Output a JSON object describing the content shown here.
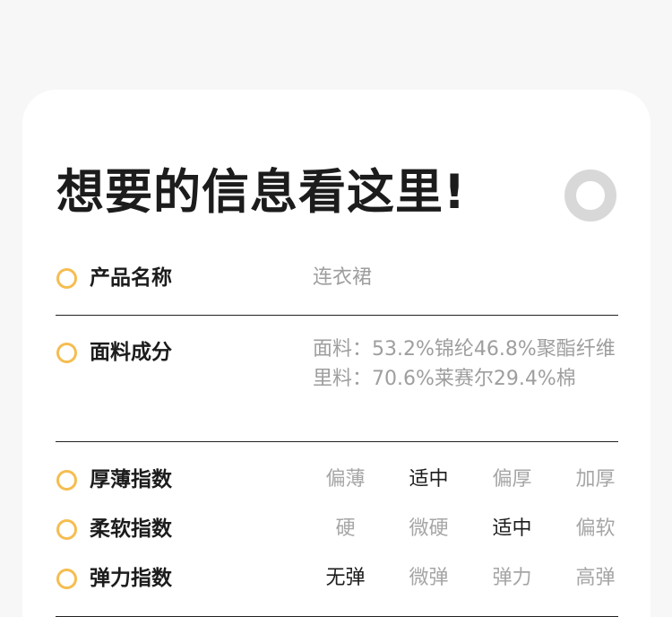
{
  "card": {
    "title": "想要的信息看这里!"
  },
  "info": {
    "product_name": {
      "label": "产品名称",
      "value": "连衣裙"
    },
    "fabric": {
      "label": "面料成分",
      "lines": [
        "面料：53.2%锦纶46.8%聚酯纤维",
        "里料：70.6%莱赛尔29.4%棉"
      ]
    }
  },
  "indices": [
    {
      "label": "厚薄指数",
      "options": [
        "偏薄",
        "适中",
        "偏厚",
        "加厚"
      ],
      "selected": 1
    },
    {
      "label": "柔软指数",
      "options": [
        "硬",
        "微硬",
        "适中",
        "偏软"
      ],
      "selected": 2
    },
    {
      "label": "弹力指数",
      "options": [
        "无弹",
        "微弹",
        "弹力",
        "高弹"
      ],
      "selected": 0
    }
  ],
  "colors": {
    "accent_ring": "#f5bd50",
    "text_dark": "#1c1c1c",
    "text_muted": "#9e9e9e",
    "deco_ring": "#d8d8d8"
  }
}
